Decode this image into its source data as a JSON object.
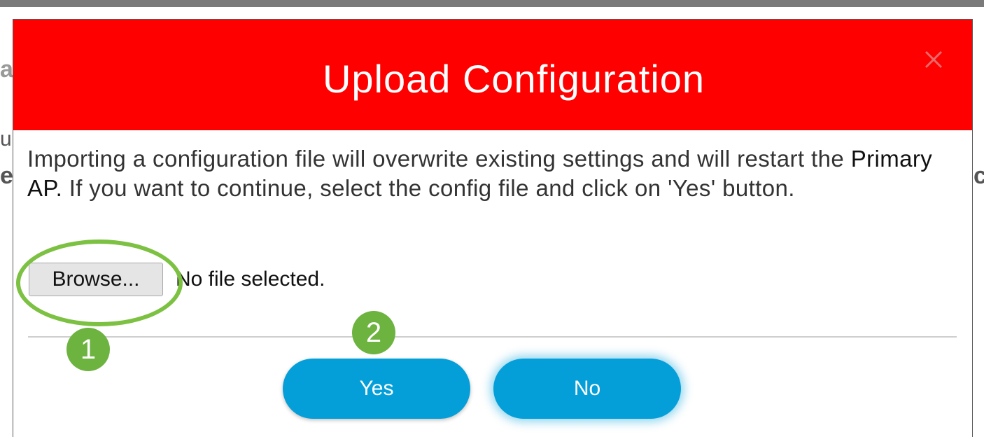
{
  "dialog": {
    "title": "Upload Configuration",
    "close_icon": "close-icon",
    "message_part1": "Importing a configuration file will overwrite existing settings and will restart the ",
    "message_highlight": "Primary AP.",
    "message_part2": "  If you want to continue, select the config file and click on 'Yes' button.",
    "browse_label": "Browse...",
    "file_status": "No file selected.",
    "yes_label": "Yes",
    "no_label": "No"
  },
  "annotations": {
    "step1": "1",
    "step2": "2"
  },
  "background_fragments": {
    "left_a": "a",
    "left_u": "u",
    "left_e": "e",
    "right_c": "c"
  },
  "colors": {
    "header_bg": "#ff0000",
    "button_bg": "#049fd9",
    "annotation_green": "#6db33f"
  }
}
